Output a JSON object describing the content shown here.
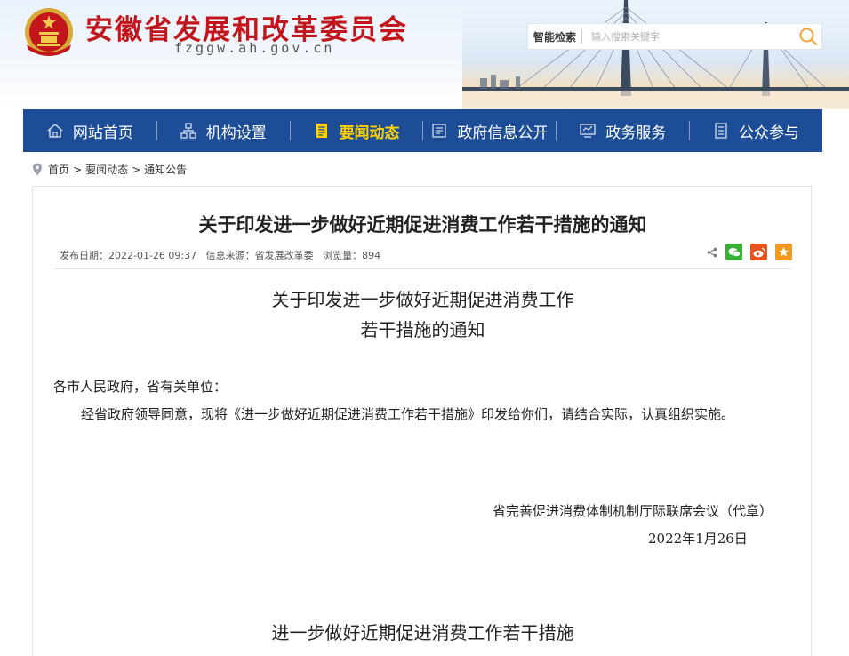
{
  "header": {
    "site_title": "安徽省发展和改革委员会",
    "site_domain": "fzggw.ah.gov.cn",
    "search": {
      "label": "智能检索",
      "placeholder": "输入搜索关键字"
    }
  },
  "nav": {
    "items": [
      {
        "label": "网站首页",
        "icon": "home-icon"
      },
      {
        "label": "机构设置",
        "icon": "org-chart-icon"
      },
      {
        "label": "要闻动态",
        "icon": "document-icon",
        "active": true
      },
      {
        "label": "政府信息公开",
        "icon": "info-board-icon"
      },
      {
        "label": "政务服务",
        "icon": "monitor-icon"
      },
      {
        "label": "公众参与",
        "icon": "list-icon"
      }
    ],
    "active_color": "#ffd200",
    "background": "#1d4d96"
  },
  "breadcrumb": {
    "items": [
      "首页",
      "要闻动态",
      "通知公告"
    ],
    "separator": ">"
  },
  "article": {
    "title": "关于印发进一步做好近期促进消费工作若干措施的通知",
    "meta": {
      "publish_label": "发布日期：",
      "publish_date": "2022-01-26 09:37",
      "source_label": "信息来源：",
      "source": "省发展改革委",
      "views_label": "浏览量：",
      "views": "894"
    },
    "share": [
      "share-icon",
      "wechat-icon",
      "weibo-icon",
      "favorite-icon"
    ],
    "doc_heading_line1": "关于印发进一步做好近期促进消费工作",
    "doc_heading_line2": "若干措施的通知",
    "salutation": "各市人民政府，省有关单位：",
    "paragraph": "经省政府领导同意，现将《进一步做好近期促进消费工作若干措施》印发给你们，请结合实际，认真组织实施。",
    "signature": "省完善促进消费体制机制厅际联席会议（代章）",
    "date": "2022年1月26日",
    "attachment_heading": "进一步做好近期促进消费工作若干措施"
  },
  "colors": {
    "title_red": "#c3161c",
    "wechat_green": "#39b035",
    "weibo_orange": "#e8541e",
    "favorite_orange": "#f39a1b"
  }
}
